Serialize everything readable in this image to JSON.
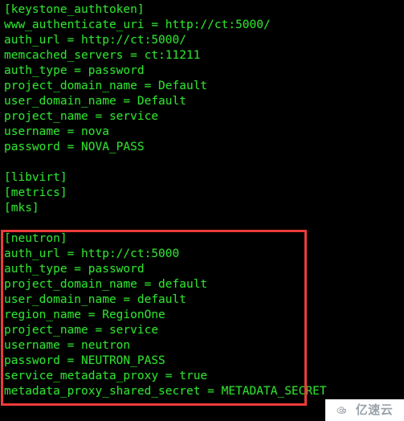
{
  "terminal": {
    "background_color": "#000000",
    "text_color": "#2fdd2f",
    "lines": [
      "[keystone_authtoken]",
      "www_authenticate_uri = http://ct:5000/",
      "auth_url = http://ct:5000/",
      "memcached_servers = ct:11211",
      "auth_type = password",
      "project_domain_name = Default",
      "user_domain_name = Default",
      "project_name = service",
      "username = nova",
      "password = NOVA_PASS",
      "",
      "[libvirt]",
      "[metrics]",
      "[mks]",
      "",
      "[neutron]",
      "auth_url = http://ct:5000",
      "auth_type = password",
      "project_domain_name = default",
      "user_domain_name = default",
      "region_name = RegionOne",
      "project_name = service",
      "username = neutron",
      "password = NEUTRON_PASS",
      "service_metadata_proxy = true",
      "metadata_proxy_shared_secret = METADATA_SECRET"
    ]
  },
  "highlight": {
    "label": "neutron-section-highlight",
    "color": "#ec3b3b",
    "first_line_index": 15,
    "last_line_index": 25
  },
  "watermark": {
    "text": "亿速云",
    "icon": "cloud-icon",
    "color": "#9aa3ab",
    "background_color": "#ffffff"
  }
}
